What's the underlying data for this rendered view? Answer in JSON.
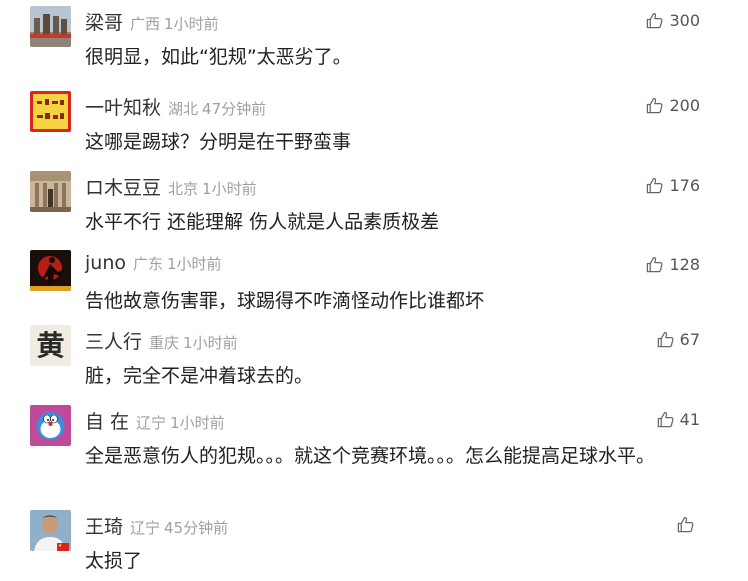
{
  "comments": [
    {
      "avatar": "landmark-statue-photo",
      "username": "梁哥",
      "location": "广西",
      "time": "1小时前",
      "likes": "300",
      "text": "很明显，如此“犯规”太恶劣了。"
    },
    {
      "avatar": "calligraphy-red-seal",
      "username": "一叶知秋",
      "location": "湖北",
      "time": "47分钟前",
      "likes": "200",
      "text": "这哪是踢球？分明是在干野蛮事"
    },
    {
      "avatar": "classical-building-photo",
      "username": "ロ木豆豆",
      "location": "北京",
      "time": "1小时前",
      "likes": "176",
      "text": "水平不行 还能理解 伤人就是人品素质极差"
    },
    {
      "avatar": "red-martial-arts-figure",
      "username": "juno",
      "location": "广东",
      "time": "1小时前",
      "likes": "128",
      "text": "告他故意伤害罪，球踢得不咋滴怪动作比谁都坏"
    },
    {
      "avatar": "calligraphy-character-huang",
      "avatar_char": "黄",
      "username": "三人行",
      "location": "重庆",
      "time": "1小时前",
      "likes": "67",
      "text": "脏，完全不是冲着球去的。"
    },
    {
      "avatar": "doraemon-cartoon",
      "username": "自 在",
      "location": "辽宁",
      "time": "1小时前",
      "likes": "41",
      "text": "全是恶意伤人的犯规。。。就这个竞赛环境。。。怎么能提高足球水平。"
    },
    {
      "avatar": "man-portrait-with-flag",
      "username": "王琦",
      "location": "辽宁",
      "time": "45分钟前",
      "likes": "",
      "text": "太损了"
    }
  ],
  "icons": {
    "like": "thumbs-up-outline-icon"
  },
  "colors": {
    "username": "#333333",
    "meta": "#a0a0a0",
    "text": "#222222",
    "like": "#555555"
  }
}
